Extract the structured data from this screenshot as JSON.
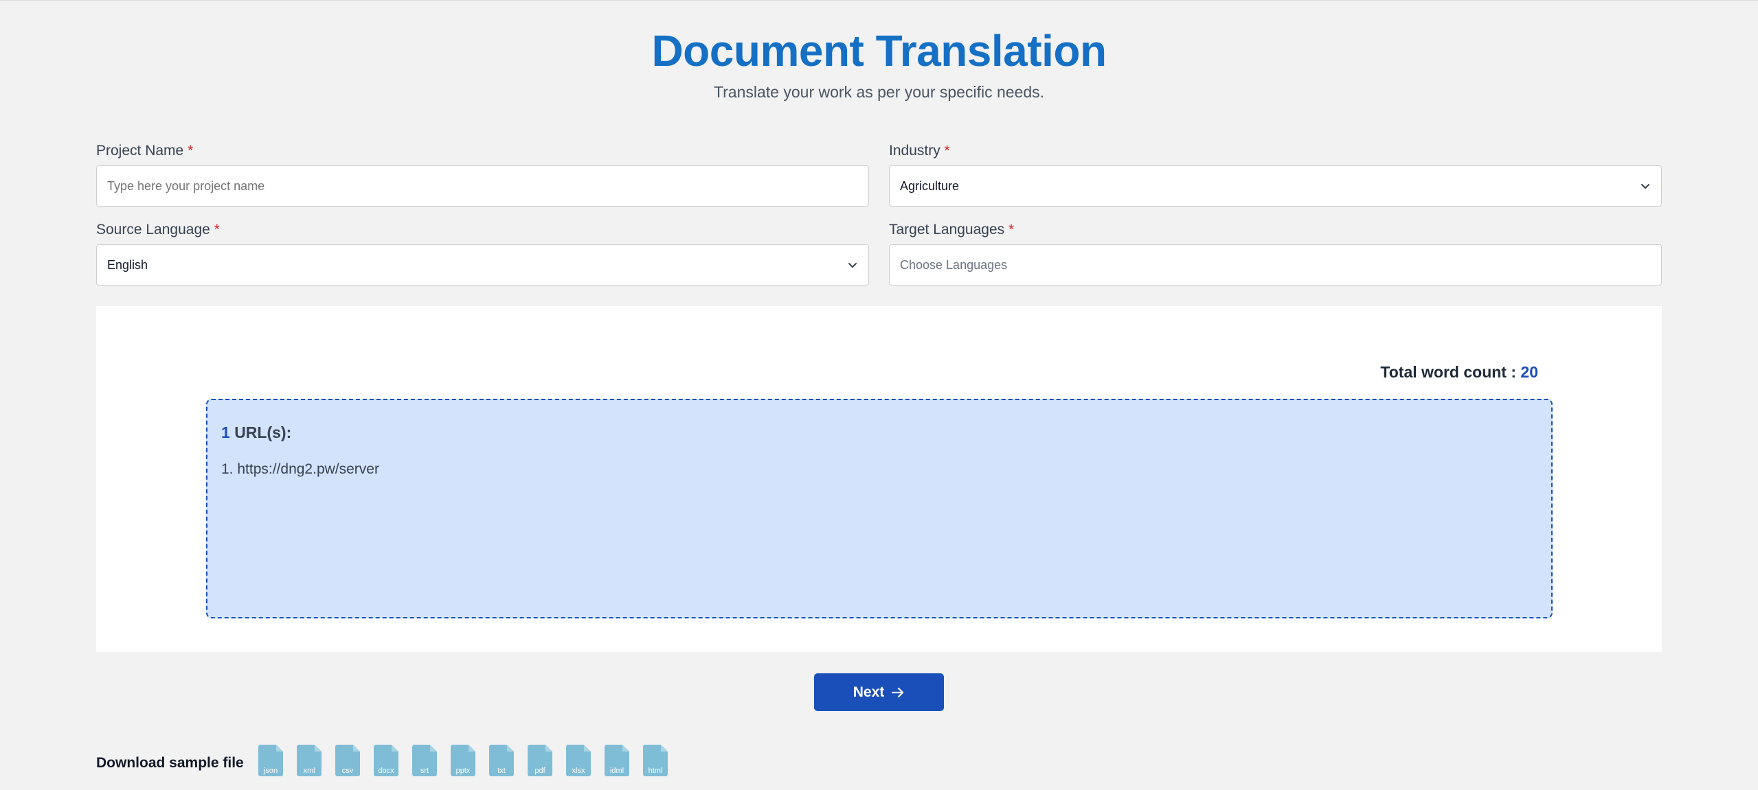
{
  "header": {
    "title": "Document Translation",
    "subtitle": "Translate your work as per your specific needs."
  },
  "form": {
    "project_name": {
      "label": "Project Name",
      "required_mark": "*",
      "placeholder": "Type here your project name",
      "value": ""
    },
    "industry": {
      "label": "Industry",
      "required_mark": "*",
      "selected": "Agriculture"
    },
    "source_language": {
      "label": "Source Language",
      "required_mark": "*",
      "selected": "English"
    },
    "target_languages": {
      "label": "Target Languages",
      "required_mark": "*",
      "placeholder": "Choose Languages"
    }
  },
  "panel": {
    "word_count_label": "Total word count :",
    "word_count_value": "20",
    "url_count": "1",
    "url_heading": "URL(s):",
    "urls": [
      {
        "index": "1.",
        "url": "https://dng2.pw/server"
      }
    ]
  },
  "next_button": {
    "label": "Next",
    "icon": "arrow-right-icon"
  },
  "download": {
    "label": "Download sample file",
    "files": [
      "json",
      "xml",
      "csv",
      "docx",
      "srt",
      "pptx",
      "txt",
      "pdf",
      "xlsx",
      "idml",
      "html"
    ]
  },
  "colors": {
    "title": "#1570c5",
    "accent": "#1a4fba",
    "required": "#dc2626",
    "url_box_bg": "#d3e3fb",
    "file_icon": "#7fbdd6"
  }
}
